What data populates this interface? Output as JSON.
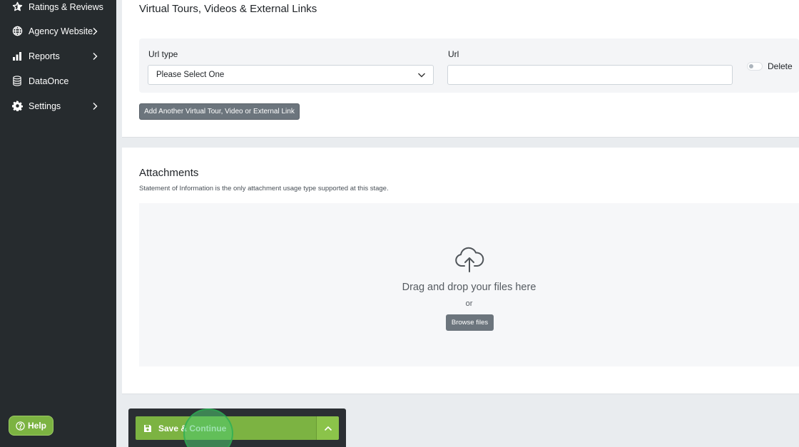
{
  "sidebar": {
    "items": [
      {
        "label": "Ratings & Reviews",
        "icon": "star-icon",
        "has_chevron": false
      },
      {
        "label": "Agency Website",
        "icon": "globe-icon",
        "has_chevron": true
      },
      {
        "label": "Reports",
        "icon": "bar-chart-icon",
        "has_chevron": true
      },
      {
        "label": "DataOnce",
        "icon": "database-icon",
        "has_chevron": false
      },
      {
        "label": "Settings",
        "icon": "gear-icon",
        "has_chevron": true
      }
    ],
    "help_label": "Help"
  },
  "links_section": {
    "title": "Virtual Tours, Videos & External Links",
    "url_type_label": "Url type",
    "url_type_value": "Please Select One",
    "url_label": "Url",
    "url_value": "",
    "delete_label": "Delete",
    "delete_toggle_on": false,
    "add_button_label": "Add Another Virtual Tour, Video or External Link"
  },
  "attachments": {
    "title": "Attachments",
    "note": "Statement of Information is the only attachment usage type supported at this stage.",
    "drop_text": "Drag and drop your files here",
    "or_text": "or",
    "browse_label": "Browse files"
  },
  "action_bar": {
    "save_label": "Save & Continue"
  },
  "colors": {
    "sidebar_bg": "#262b2e",
    "accent_green": "#7cb342",
    "secondary_button": "#6c757d"
  }
}
